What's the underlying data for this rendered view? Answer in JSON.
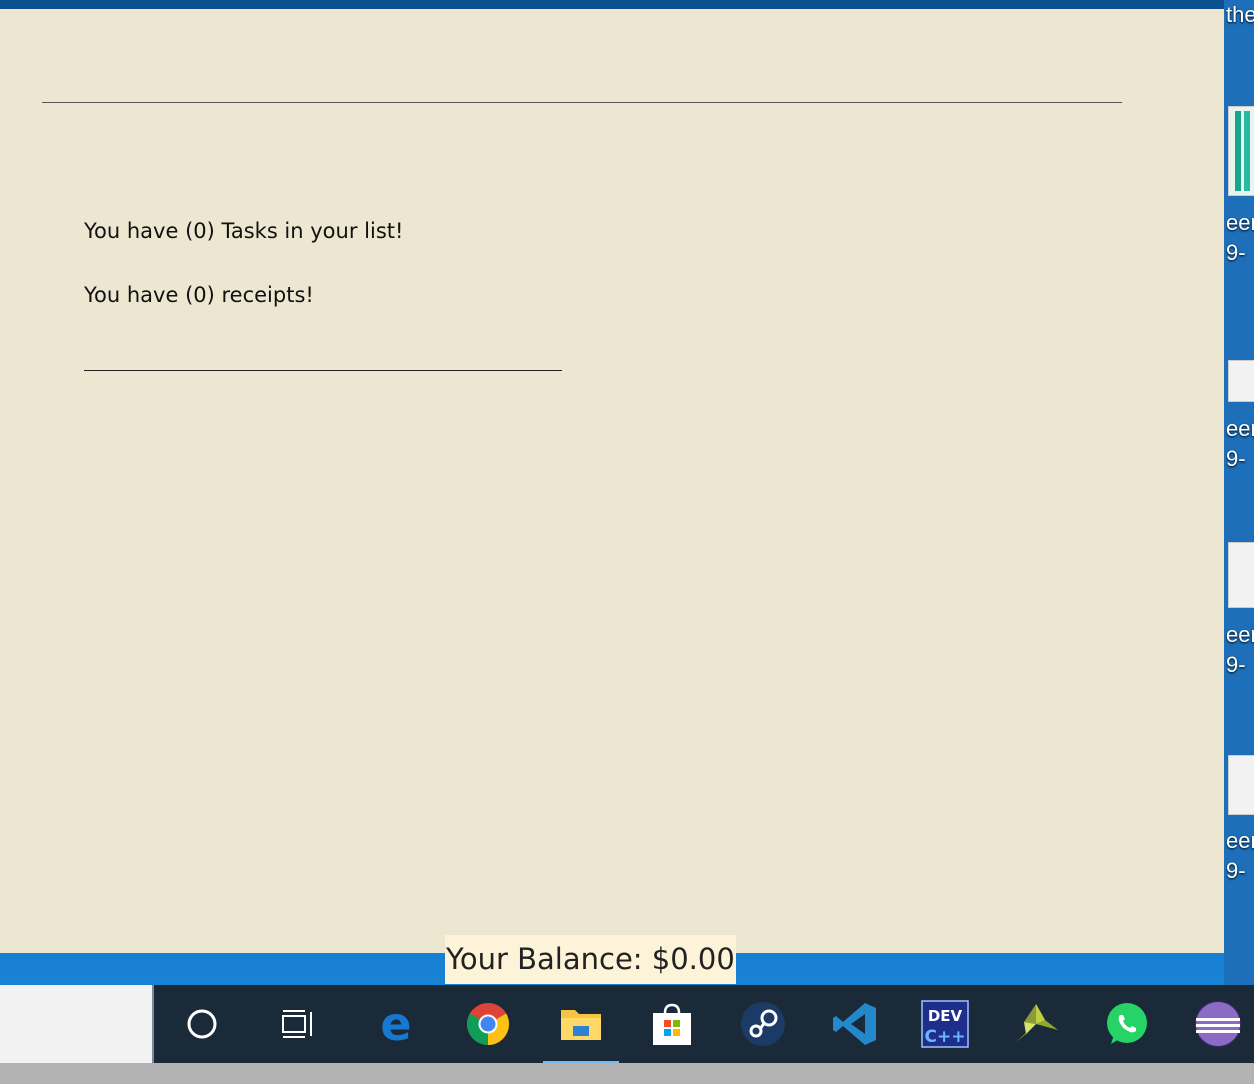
{
  "desktop": {
    "partial_labels": [
      "the",
      "een",
      "9-",
      "een",
      "9-",
      "een",
      "9-",
      "een",
      "9-"
    ]
  },
  "main": {
    "tasks_text": "You have (0) Tasks in your list!",
    "receipts_text": "You have (0) receipts!",
    "balance_text": "Your Balance: $0.00"
  },
  "taskbar": {
    "items": [
      {
        "name": "cortana-search-icon"
      },
      {
        "name": "task-view-icon"
      },
      {
        "name": "edge-icon"
      },
      {
        "name": "chrome-icon"
      },
      {
        "name": "file-explorer-icon",
        "active": true
      },
      {
        "name": "microsoft-store-icon"
      },
      {
        "name": "steam-icon"
      },
      {
        "name": "vscode-icon"
      },
      {
        "name": "dev-cpp-icon",
        "label": "DEV C++"
      },
      {
        "name": "unity-style-icon"
      },
      {
        "name": "whatsapp-icon"
      },
      {
        "name": "eclipse-icon"
      }
    ]
  },
  "colors": {
    "window_bg": "#ede6d0",
    "balance_bg": "#fdf3d9",
    "taskbar_bg": "#1b2a38"
  }
}
